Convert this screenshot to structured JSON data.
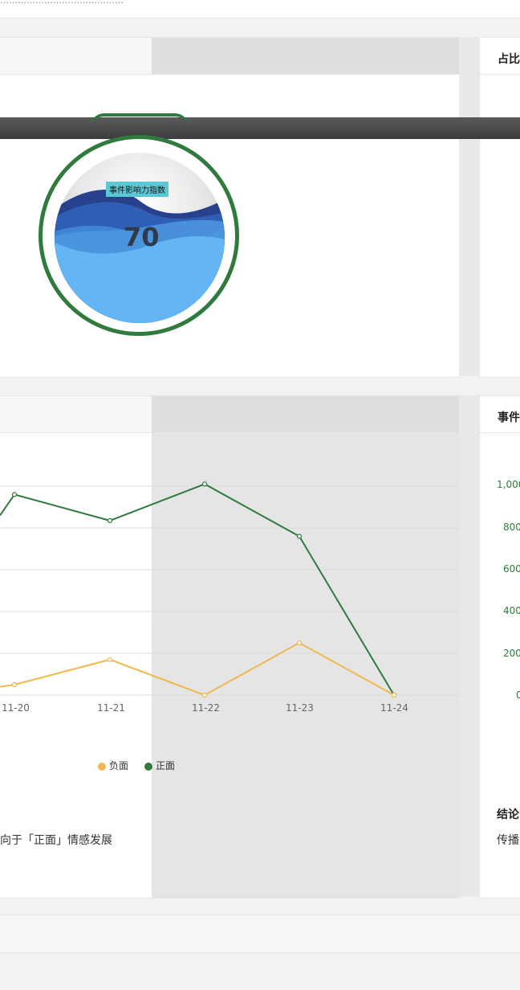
{
  "header": {
    "faint_text": "……………………………………"
  },
  "right_panels": {
    "top_title": "占比",
    "bottom_title": "事件"
  },
  "gauge": {
    "label": "事件影响力指数",
    "value": "70"
  },
  "trend_chart": {
    "x_ticks": [
      "11-20",
      "11-21",
      "11-22",
      "11-23",
      "11-24"
    ],
    "legend": [
      "负面",
      "正面"
    ],
    "summary": "向于「正面」情感发展"
  },
  "bar_chart": {
    "y_ticks": [
      "1,000",
      "800",
      "600",
      "400",
      "200",
      "0"
    ],
    "conclusion_label": "结论",
    "spread_label": "传播"
  },
  "chart_data": {
    "type": "line",
    "categories": [
      "11-20",
      "11-21",
      "11-22",
      "11-23",
      "11-24"
    ],
    "series": [
      {
        "name": "正面",
        "values": [
          960,
          835,
          1010,
          760,
          0
        ]
      },
      {
        "name": "负面",
        "values": [
          50,
          170,
          0,
          250,
          0
        ]
      }
    ],
    "colors": {
      "正面": "#2f7a3c",
      "负面": "#f0b84e"
    }
  }
}
